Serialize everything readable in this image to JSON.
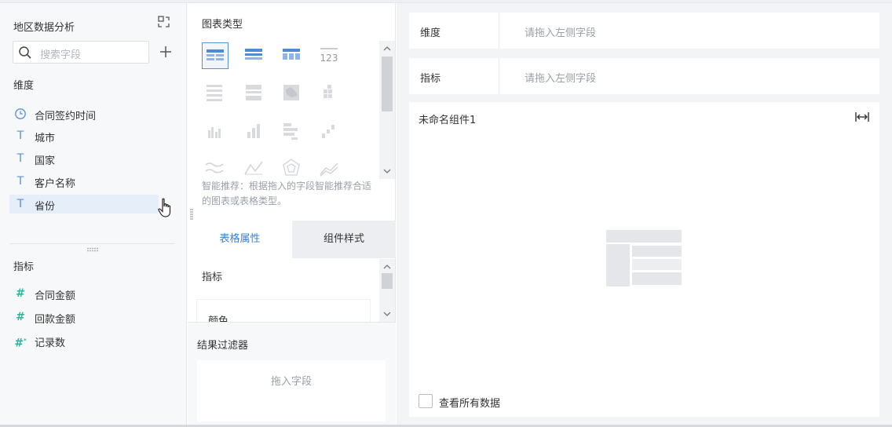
{
  "left_panel": {
    "title": "地区数据分析",
    "search_placeholder": "搜索字段",
    "dimensions_label": "维度",
    "dimensions": [
      {
        "label": "合同签约时间",
        "icon": "clock-icon"
      },
      {
        "label": "城市",
        "icon": "text-type-icon"
      },
      {
        "label": "国家",
        "icon": "text-type-icon"
      },
      {
        "label": "客户名称",
        "icon": "text-type-icon"
      },
      {
        "label": "省份",
        "icon": "text-type-icon"
      }
    ],
    "metrics_label": "指标",
    "metrics": [
      {
        "label": "合同金额",
        "icon": "number-type-icon"
      },
      {
        "label": "回款金额",
        "icon": "number-type-icon"
      },
      {
        "label": "记录数",
        "icon": "number-count-icon"
      }
    ]
  },
  "middle_panel": {
    "chart_type_title": "图表类型",
    "hint": "智能推荐：根据拖入的字段智能推荐合适的图表或表格类型。",
    "tabs": {
      "table_props": "表格属性",
      "component_style": "组件样式"
    },
    "prop_section_label": "指标",
    "color_label": "颜色",
    "filter_label": "结果过滤器",
    "filter_drop_text": "拖入字段"
  },
  "right_panel": {
    "dimension_row": {
      "label": "维度",
      "placeholder": "请拖入左侧字段"
    },
    "metric_row": {
      "label": "指标",
      "placeholder": "请拖入左侧字段"
    },
    "component_title": "未命名组件1",
    "view_all_label": "查看所有数据"
  },
  "colors": {
    "accent": "#3b7fd1",
    "icon_blue": "#5b8fd9",
    "metric_green": "#2fb39a"
  }
}
